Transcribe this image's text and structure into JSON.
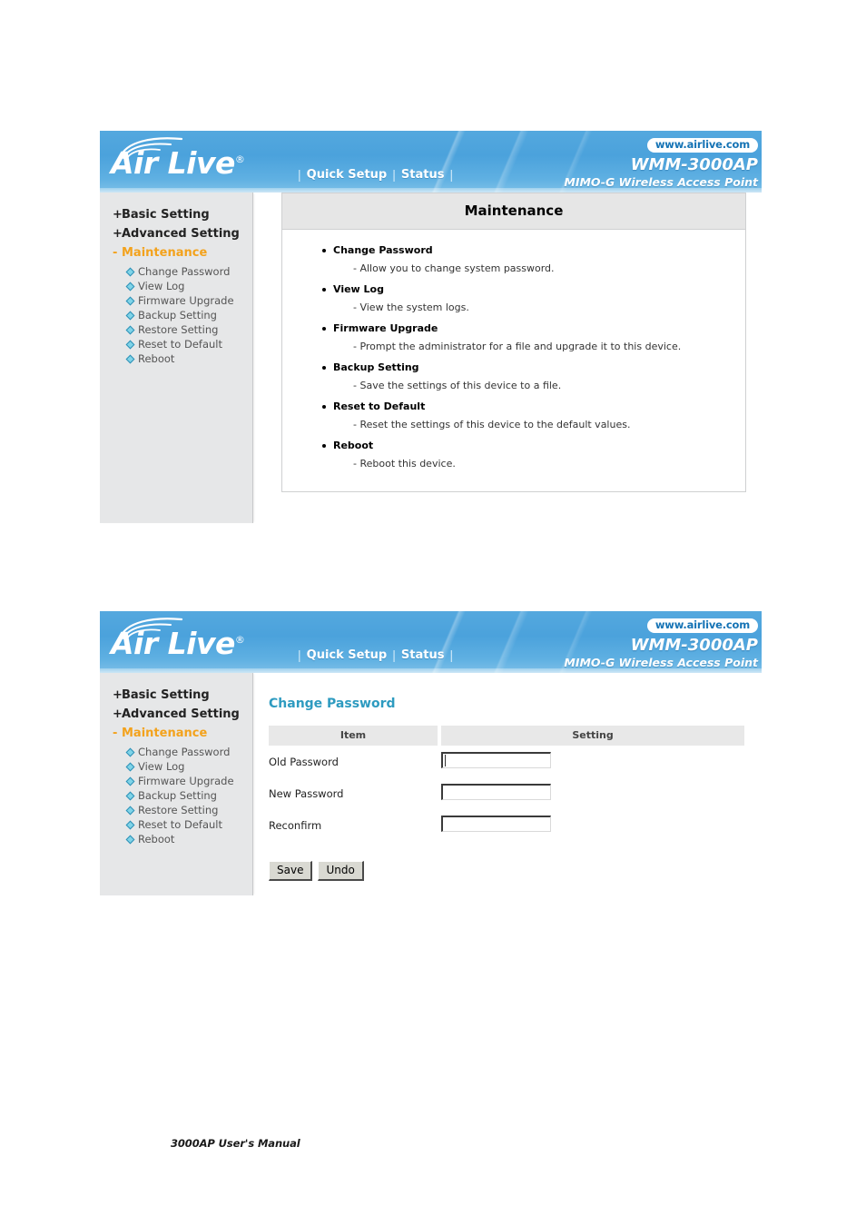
{
  "document": {
    "footer_text": "3000AP User's Manual"
  },
  "banner": {
    "logo_text": "Air Live",
    "logo_registered": "®",
    "nav": [
      {
        "label": "Quick Setup"
      },
      {
        "label": "Status"
      }
    ],
    "url_badge": "www.airlive.com",
    "model": "WMM-3000AP",
    "tagline": "MIMO-G Wireless Access Point",
    "accent_color": "#4ba2dc"
  },
  "sidebar": {
    "groups": [
      {
        "prefix": "+",
        "label": "Basic Setting",
        "active": false
      },
      {
        "prefix": "+",
        "label": "Advanced Setting",
        "active": false
      },
      {
        "prefix": "-",
        "label": "Maintenance",
        "active": true
      }
    ],
    "sub_items": [
      {
        "label": "Change Password"
      },
      {
        "label": "View Log"
      },
      {
        "label": "Firmware Upgrade"
      },
      {
        "label": "Backup Setting"
      },
      {
        "label": "Restore Setting"
      },
      {
        "label": "Reset to Default"
      },
      {
        "label": "Reboot"
      }
    ],
    "active_color": "#f3a21c",
    "bullet_color": "#7fd4e8"
  },
  "screen1": {
    "panel_title": "Maintenance",
    "help_items": [
      {
        "heading": "Change Password",
        "description": "- Allow you to change system password."
      },
      {
        "heading": "View Log",
        "description": "- View the system logs."
      },
      {
        "heading": "Firmware Upgrade",
        "description": "- Prompt the administrator for a file and upgrade it to this device."
      },
      {
        "heading": "Backup Setting",
        "description": "- Save the settings of this device to a file."
      },
      {
        "heading": "Reset to Default",
        "description": "- Reset the settings of this device to the default values."
      },
      {
        "heading": "Reboot",
        "description": "- Reboot this device."
      }
    ]
  },
  "screen2": {
    "section_title": "Change Password",
    "section_title_color": "#2e9bc0",
    "table_headers": {
      "item": "Item",
      "setting": "Setting"
    },
    "rows": [
      {
        "label": "Old Password",
        "value": "",
        "focused": true
      },
      {
        "label": "New Password",
        "value": "",
        "focused": false
      },
      {
        "label": "Reconfirm",
        "value": "",
        "focused": false
      }
    ],
    "buttons": [
      {
        "label": "Save"
      },
      {
        "label": "Undo"
      }
    ]
  }
}
